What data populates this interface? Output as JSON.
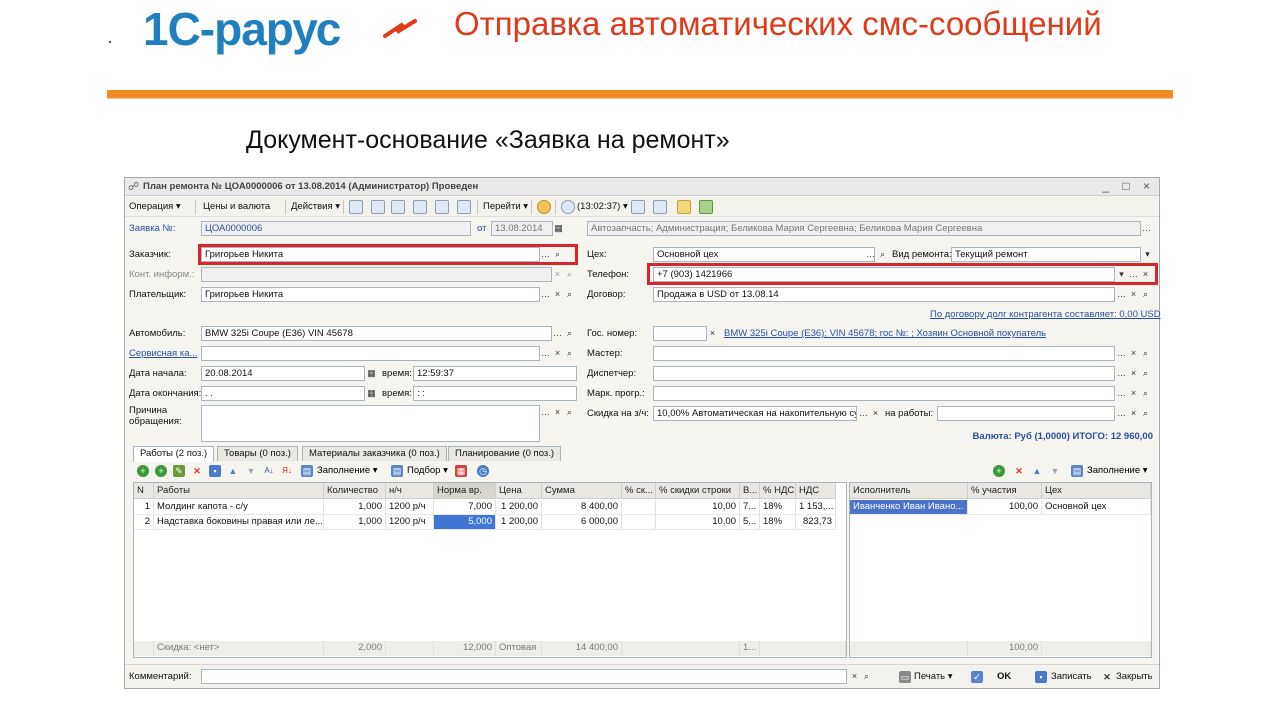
{
  "slide": {
    "logo": "1С-рарус",
    "title": "Отправка автоматических смс-сообщений",
    "subtitle": "Документ-основание «Заявка на ремонт»"
  },
  "window": {
    "title": "План ремонта № ЦОА0000006 от 13.08.2014 (Администратор) Проведен",
    "controls": "_ □ ×"
  },
  "toolbar": {
    "operation": "Операция ▾",
    "prices": "Цены и валюта",
    "actions": "Действия ▾",
    "goto": "Перейти ▾",
    "time": "(13:02:37) ▾"
  },
  "header": {
    "number_label": "Заявка №:",
    "number": "ЦОА0000006",
    "date_label": "от",
    "date": "13.08.2014",
    "org": "Автозапчасть; Администрация; Беликова Мария Сергеевна; Беликова Мария Сергеевна"
  },
  "left": {
    "customer_label": "Заказчик:",
    "customer": "Григорьев Никита",
    "contact_label": "Конт. информ.:",
    "payer_label": "Плательщик:",
    "payer": "Григорьев Никита",
    "car_label": "Автомобиль:",
    "car": "BMW 325i Coupe (E36) VIN 45678",
    "service_label": "Сервисная ка...",
    "start_label": "Дата начала:",
    "start_date": "20.08.2014",
    "start_time_label": "время:",
    "start_time": "12:59:37",
    "end_label": "Дата окончания:",
    "end_date": " .  .",
    "end_time_label": "время:",
    "end_time": " :  :",
    "reason_label": "Причина обращения:"
  },
  "right": {
    "shop_label": "Цех:",
    "shop": "Основной цех",
    "repair_type_label": "Вид ремонта:",
    "repair_type": "Текущий ремонт",
    "phone_label": "Телефон:",
    "phone": "+7 (903) 1421966",
    "contract_label": "Договор:",
    "contract": "Продажа в USD от 13.08.14",
    "debt_link": "По договору долг контрагента составляет: 0,00 USD",
    "plate_label": "Гос. номер:",
    "car_link": "BMW 325i Coupe (E36); VIN 45678; гос №: ; Хозяин Основной покупатель",
    "master_label": "Мастер:",
    "dispatcher_label": "Диспетчер:",
    "program_label": "Марк. прогр.:",
    "discount_label": "Скидка на з/ч:",
    "discount": "10,00% Автоматическая на накопительную сумм",
    "works_label": "на работы:",
    "totals": "Валюта: Руб (1,0000) ИТОГО: 12 960,00"
  },
  "tabs": [
    "Работы (2 поз.)",
    "Товары (0 поз.)",
    "Материалы заказчика (0 поз.)",
    "Планирование (0 поз.)"
  ],
  "works_cmd": {
    "fill": "Заполнение ▾",
    "pick": "Подбор ▾"
  },
  "works": {
    "columns": [
      "N",
      "Работы",
      "Количество",
      "н/ч",
      "Норма вр.",
      "Цена",
      "Сумма",
      "% ск...",
      "% скидки строки",
      "В...",
      "% НДС",
      "НДС"
    ],
    "rows": [
      [
        "1",
        "Молдинг капота - с/у",
        "1,000",
        "1200 р/ч",
        "7,000",
        "1 200,00",
        "8 400,00",
        "",
        "10,00",
        "7...",
        "18%",
        "1 153,..."
      ],
      [
        "2",
        "Надставка боковины правая или ле...",
        "1,000",
        "1200 р/ч",
        "5,000",
        "1 200,00",
        "6 000,00",
        "",
        "10,00",
        "5...",
        "18%",
        "823,73"
      ]
    ],
    "footer": [
      "Скидка: <нет>",
      "2,000",
      "12,000",
      "Оптовая",
      "14 400,00",
      "1..."
    ]
  },
  "executors_cmd": {
    "fill": "Заполнение ▾"
  },
  "executors": {
    "columns": [
      "Исполнитель",
      "% участия",
      "Цех"
    ],
    "rows": [
      [
        "Иванченко Иван Ивано...",
        "100,00",
        "Основной цех"
      ]
    ],
    "footer": "100,00"
  },
  "bottom": {
    "comment_label": "Комментарий:",
    "print": "Печать ▾",
    "ok": "OK",
    "save": "Записать",
    "close": "Закрыть"
  },
  "colors": {
    "accent": "#f08c28",
    "title": "#e03a1a",
    "logo": "#1f7fbf",
    "highlight": "#d8252e",
    "link": "#2a4fa3"
  }
}
